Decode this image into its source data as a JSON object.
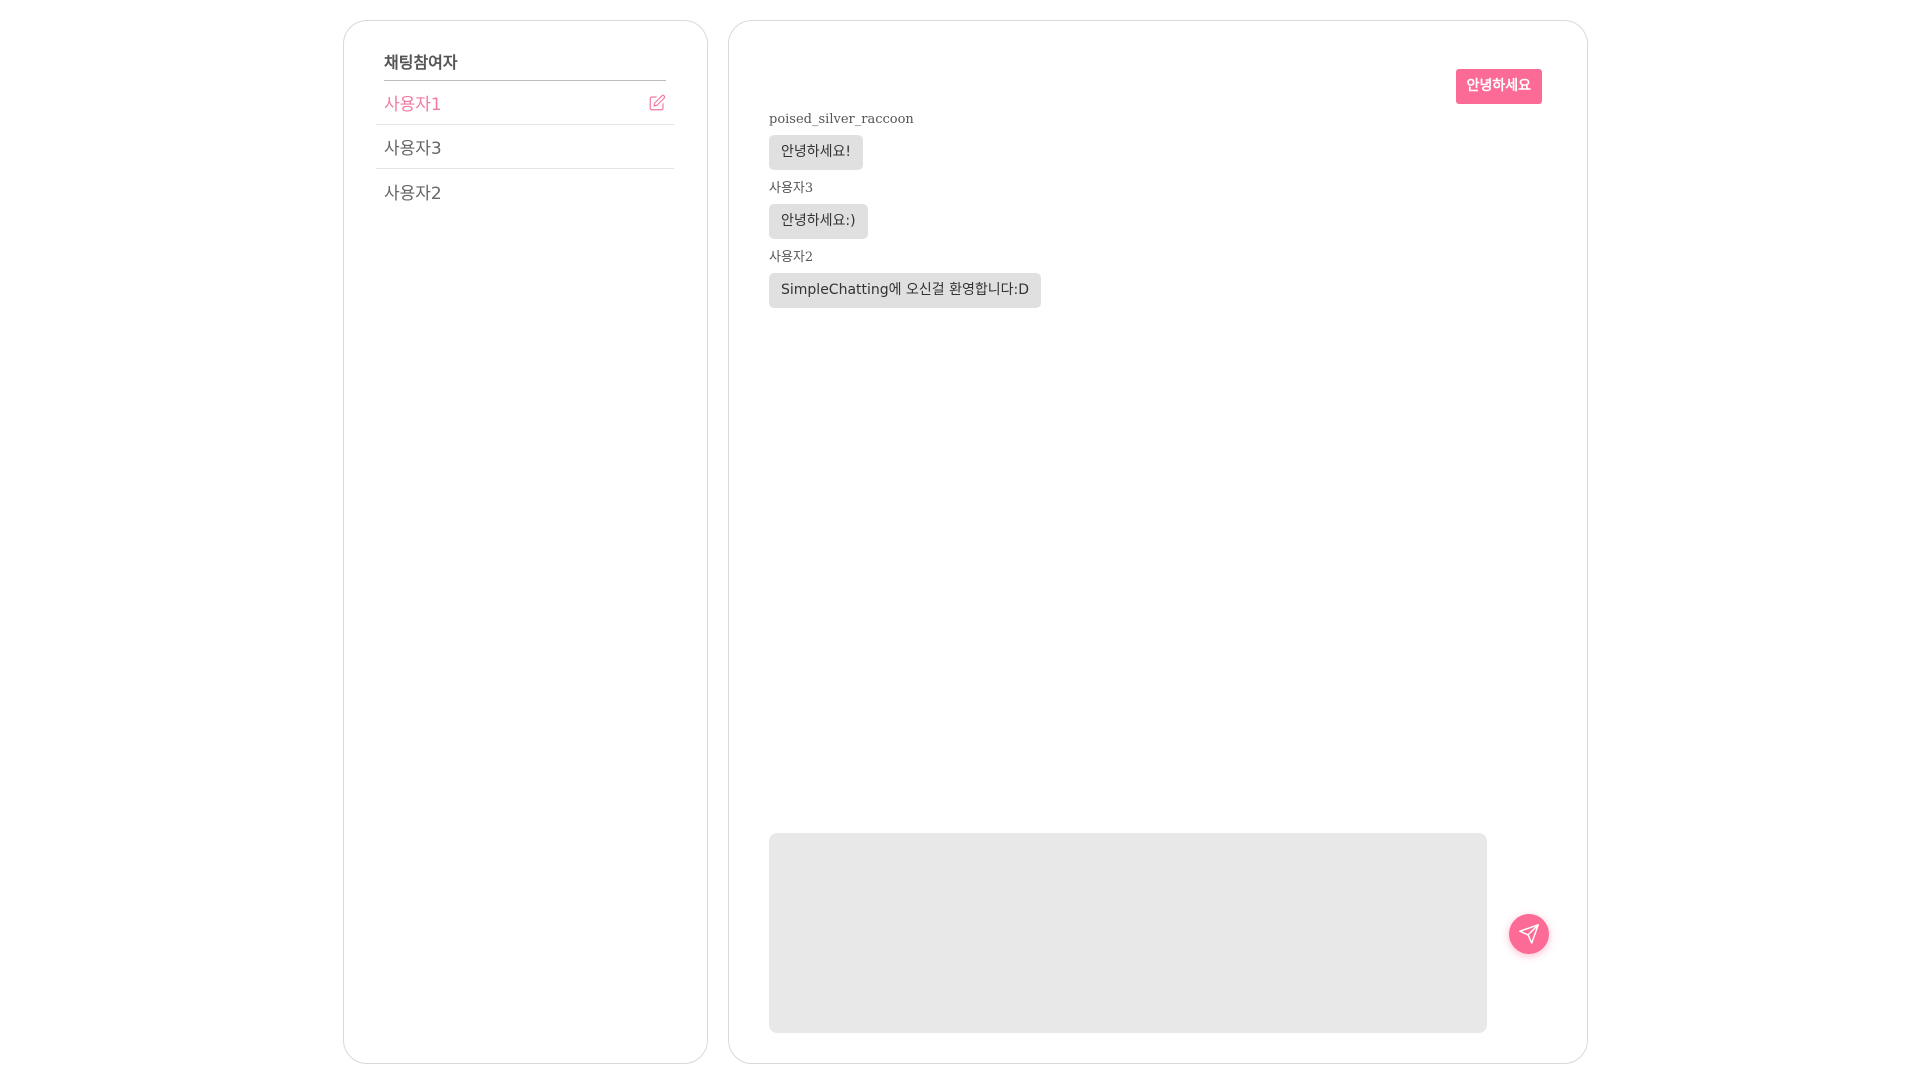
{
  "participants": {
    "title": "채팅참여자",
    "items": [
      {
        "label": "사용자1",
        "active": true,
        "icon": "edit-icon"
      },
      {
        "label": "사용자3",
        "active": false
      },
      {
        "label": "사용자2",
        "active": false
      }
    ]
  },
  "chat": {
    "my_message": "안녕하세요",
    "messages": [
      {
        "sender": "poised_silver_raccoon",
        "text": "안녕하세요!"
      },
      {
        "sender": "사용자3",
        "text": "안녕하세요:)"
      },
      {
        "sender": "사용자2",
        "text": "SimpleChatting에 오신걸 환영합니다:D"
      }
    ],
    "input_value": "",
    "send_icon": "paper-plane-icon"
  },
  "colors": {
    "accent": "#fc6b96",
    "active_text": "#f27ba0",
    "bubble_bg": "#e0e0e0",
    "input_bg": "#e8e8e8",
    "panel_border": "#d9d9d9"
  }
}
